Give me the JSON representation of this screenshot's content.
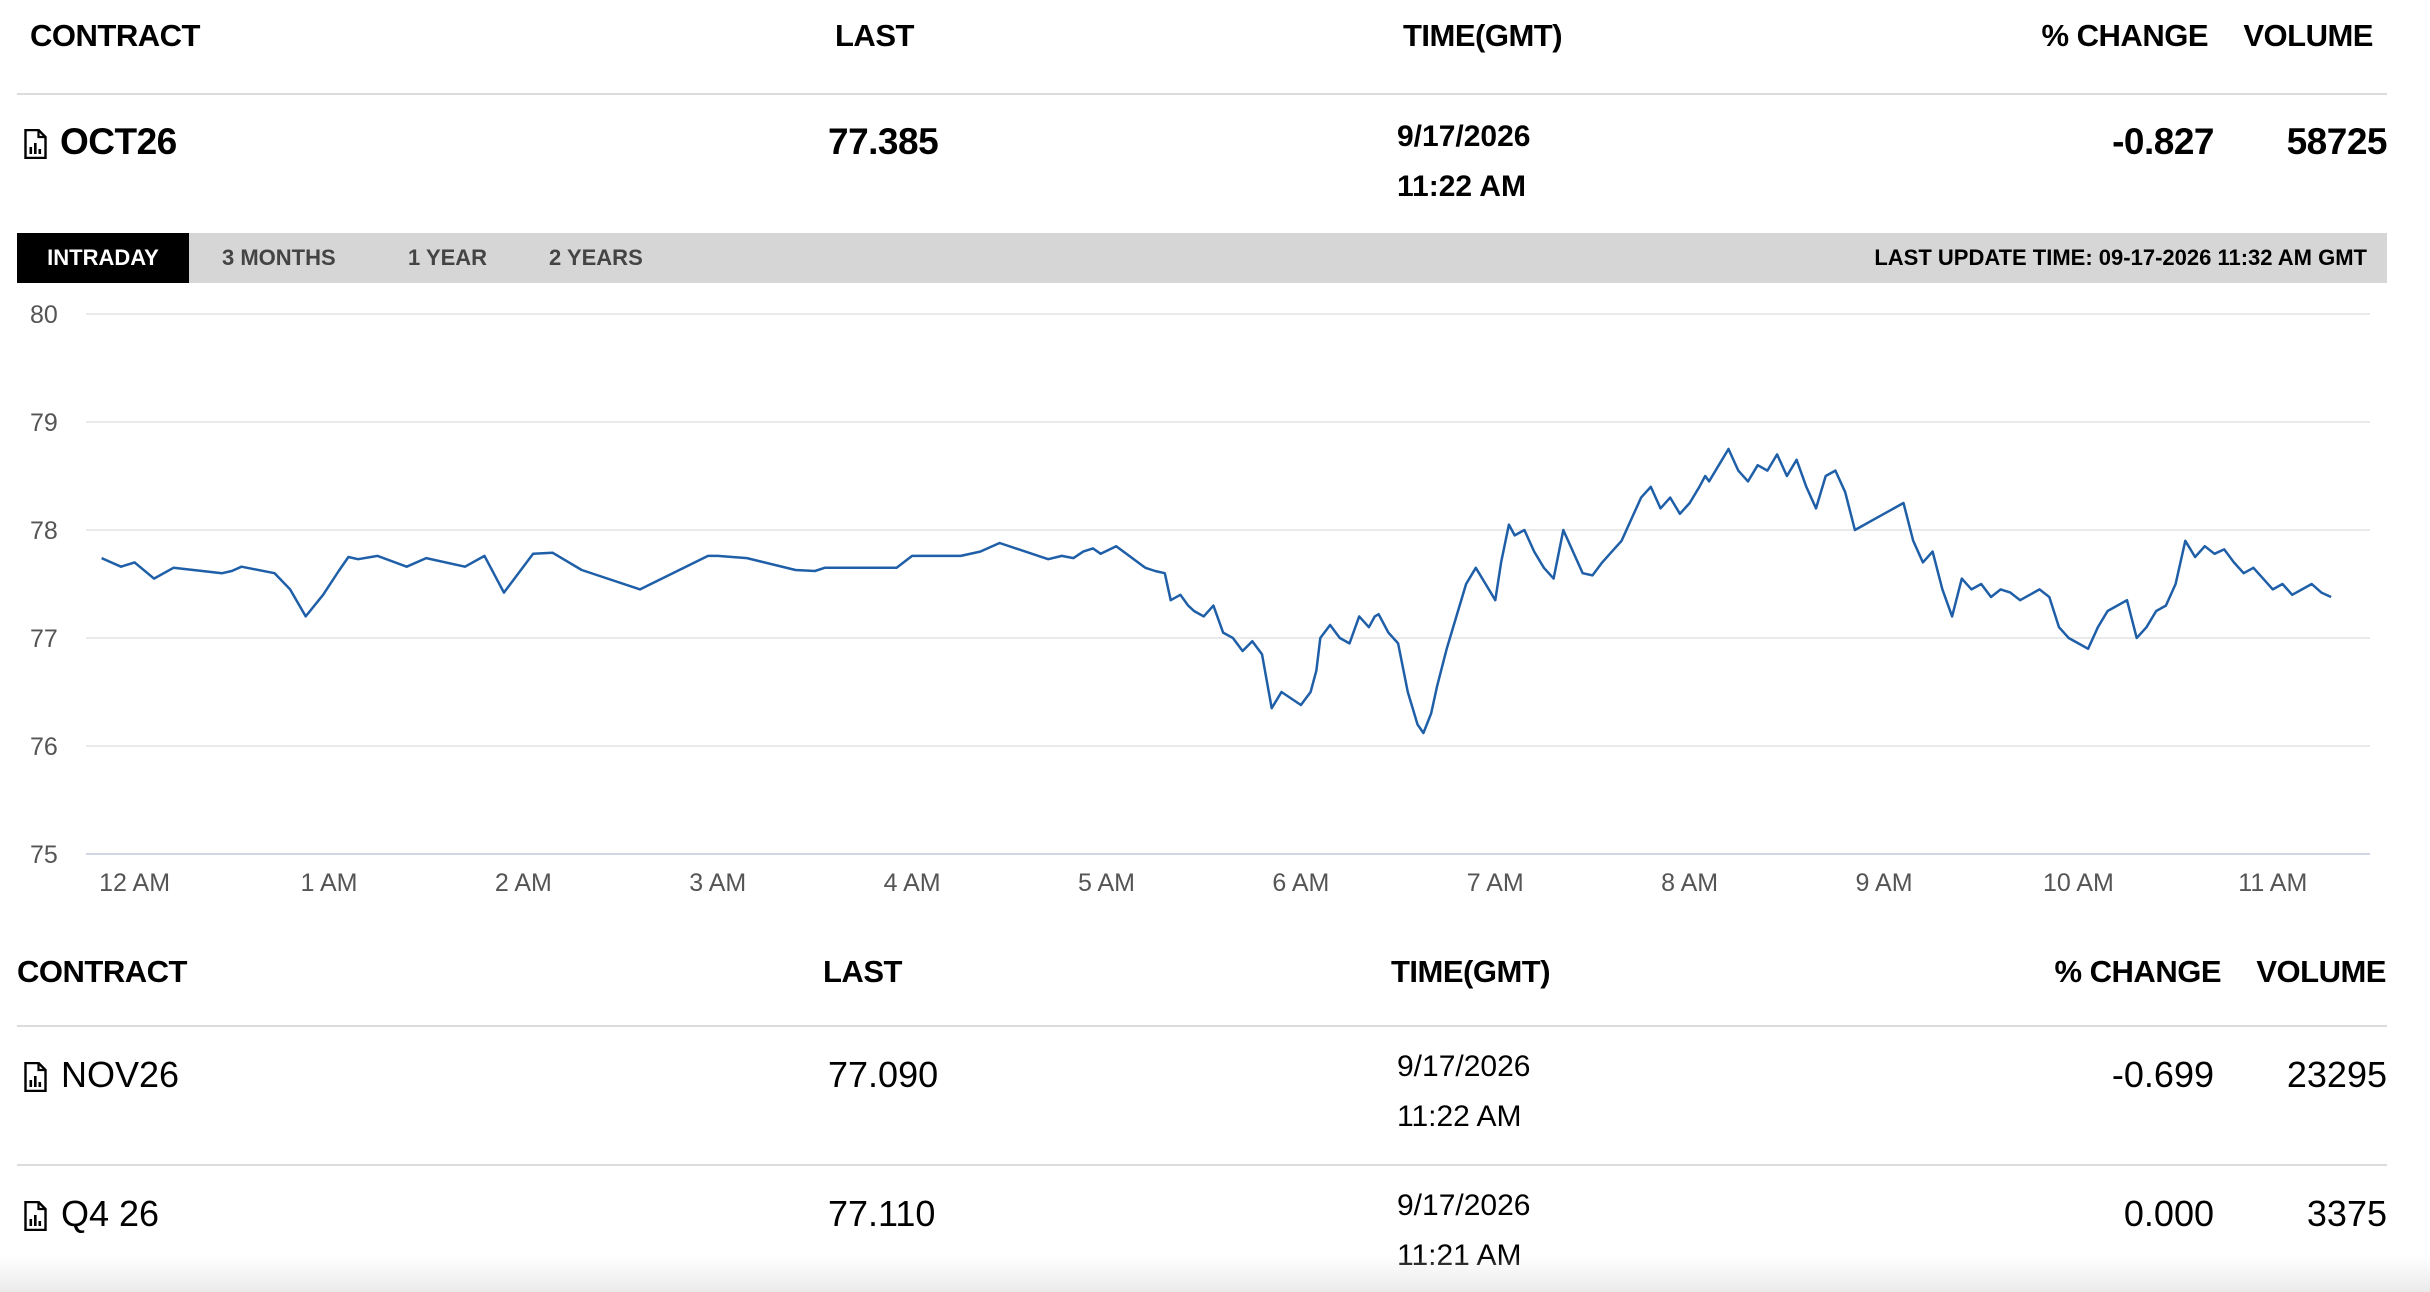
{
  "columns": {
    "contract": "CONTRACT",
    "last": "LAST",
    "time": "TIME(GMT)",
    "change": "% CHANGE",
    "volume": "VOLUME"
  },
  "main": {
    "contract": "OCT26",
    "last": "77.385",
    "date": "9/17/2026",
    "time": "11:22 AM",
    "change": "-0.827",
    "volume": "58725"
  },
  "tabs": {
    "intraday": "INTRADAY",
    "three_months": "3 MONTHS",
    "one_year": "1 YEAR",
    "two_years": "2 YEARS",
    "active": "INTRADAY"
  },
  "last_update": "LAST UPDATE TIME: 09-17-2026 11:32 AM GMT",
  "chart_data": {
    "type": "line",
    "ylim": [
      75,
      80
    ],
    "yticks": [
      80,
      79,
      78,
      77,
      76,
      75
    ],
    "xlim": [
      -0.25,
      11.5
    ],
    "xticks": [
      {
        "x": 0,
        "label": "12 AM"
      },
      {
        "x": 1,
        "label": "1 AM"
      },
      {
        "x": 2,
        "label": "2 AM"
      },
      {
        "x": 3,
        "label": "3 AM"
      },
      {
        "x": 4,
        "label": "4 AM"
      },
      {
        "x": 5,
        "label": "5 AM"
      },
      {
        "x": 6,
        "label": "6 AM"
      },
      {
        "x": 7,
        "label": "7 AM"
      },
      {
        "x": 8,
        "label": "8 AM"
      },
      {
        "x": 9,
        "label": "9 AM"
      },
      {
        "x": 10,
        "label": "10 AM"
      },
      {
        "x": 11,
        "label": "11 AM"
      }
    ],
    "grid": true,
    "line_color": "#1f5fa8",
    "x": [
      -0.17,
      -0.07,
      0.0,
      0.1,
      0.2,
      0.45,
      0.5,
      0.55,
      0.72,
      0.8,
      0.88,
      0.97,
      1.05,
      1.1,
      1.15,
      1.25,
      1.4,
      1.5,
      1.7,
      1.8,
      1.9,
      2.05,
      2.15,
      2.3,
      2.6,
      2.95,
      3.0,
      3.15,
      3.4,
      3.5,
      3.55,
      3.92,
      4.0,
      4.25,
      4.35,
      4.45,
      4.7,
      4.77,
      4.83,
      4.88,
      4.93,
      4.97,
      5.05,
      5.2,
      5.25,
      5.3,
      5.33,
      5.38,
      5.42,
      5.45,
      5.5,
      5.55,
      5.6,
      5.65,
      5.7,
      5.75,
      5.8,
      5.85,
      5.9,
      5.95,
      6.0,
      6.05,
      6.08,
      6.1,
      6.15,
      6.2,
      6.25,
      6.3,
      6.35,
      6.38,
      6.4,
      6.45,
      6.5,
      6.55,
      6.6,
      6.63,
      6.67,
      6.7,
      6.75,
      6.8,
      6.85,
      6.9,
      6.95,
      7.0,
      7.03,
      7.07,
      7.1,
      7.15,
      7.2,
      7.25,
      7.3,
      7.35,
      7.4,
      7.45,
      7.5,
      7.55,
      7.6,
      7.65,
      7.7,
      7.75,
      7.8,
      7.85,
      7.9,
      7.95,
      8.0,
      8.05,
      8.08,
      8.1,
      8.15,
      8.2,
      8.25,
      8.3,
      8.35,
      8.4,
      8.45,
      8.5,
      8.55,
      8.6,
      8.65,
      8.7,
      8.75,
      8.8,
      8.85,
      8.9,
      8.95,
      9.0,
      9.05,
      9.1,
      9.15,
      9.2,
      9.25,
      9.3,
      9.35,
      9.4,
      9.45,
      9.5,
      9.55,
      9.6,
      9.65,
      9.7,
      9.75,
      9.8,
      9.85,
      9.9,
      9.95,
      10.0,
      10.05,
      10.1,
      10.15,
      10.2,
      10.25,
      10.3,
      10.35,
      10.4,
      10.45,
      10.5,
      10.55,
      10.6,
      10.65,
      10.7,
      10.75,
      10.8,
      10.85,
      10.9,
      10.95,
      11.0,
      11.05,
      11.1,
      11.15,
      11.2,
      11.25,
      11.3,
      11.35,
      11.4
    ],
    "y": [
      77.74,
      77.66,
      77.7,
      77.55,
      77.65,
      77.6,
      77.62,
      77.66,
      77.6,
      77.45,
      77.2,
      77.4,
      77.62,
      77.75,
      77.73,
      77.76,
      77.66,
      77.74,
      77.66,
      77.76,
      77.42,
      77.78,
      77.79,
      77.63,
      77.45,
      77.76,
      77.76,
      77.74,
      77.63,
      77.62,
      77.65,
      77.65,
      77.76,
      77.76,
      77.8,
      77.88,
      77.73,
      77.76,
      77.74,
      77.8,
      77.83,
      77.78,
      77.85,
      77.65,
      77.62,
      77.6,
      77.35,
      77.4,
      77.3,
      77.25,
      77.2,
      77.3,
      77.05,
      77.0,
      76.88,
      76.97,
      76.85,
      76.35,
      76.5,
      76.44,
      76.38,
      76.5,
      76.7,
      77.0,
      77.12,
      77.0,
      76.95,
      77.2,
      77.1,
      77.2,
      77.22,
      77.05,
      76.95,
      76.5,
      76.2,
      76.12,
      76.3,
      76.55,
      76.9,
      77.2,
      77.5,
      77.65,
      77.5,
      77.35,
      77.7,
      78.05,
      77.95,
      78.0,
      77.8,
      77.65,
      77.55,
      78.0,
      77.8,
      77.6,
      77.58,
      77.7,
      77.8,
      77.9,
      78.1,
      78.3,
      78.4,
      78.2,
      78.3,
      78.15,
      78.25,
      78.4,
      78.5,
      78.45,
      78.6,
      78.75,
      78.55,
      78.45,
      78.6,
      78.55,
      78.7,
      78.5,
      78.65,
      78.4,
      78.2,
      78.5,
      78.55,
      78.35,
      78.0,
      78.05,
      78.1,
      78.15,
      78.2,
      78.25,
      77.9,
      77.7,
      77.8,
      77.45,
      77.2,
      77.55,
      77.45,
      77.5,
      77.38,
      77.45,
      77.42,
      77.35,
      77.4,
      77.45,
      77.38,
      77.1,
      77.0,
      76.95,
      76.9,
      77.1,
      77.25,
      77.3,
      77.35,
      77.0,
      77.1,
      77.25,
      77.3,
      77.5,
      77.9,
      77.75,
      77.85,
      77.78,
      77.82,
      77.7,
      77.6,
      77.65,
      77.55,
      77.45,
      77.5,
      77.4,
      77.45,
      77.5,
      77.42,
      77.38
    ],
    "line_width": 2.5
  },
  "subtable": {
    "rows": [
      {
        "contract": "NOV26",
        "last": "77.090",
        "date": "9/17/2026",
        "time": "11:22 AM",
        "change": "-0.699",
        "volume": "23295"
      },
      {
        "contract": "Q4 26",
        "last": "77.110",
        "date": "9/17/2026",
        "time": "11:21 AM",
        "change": "0.000",
        "volume": "3375"
      }
    ]
  }
}
